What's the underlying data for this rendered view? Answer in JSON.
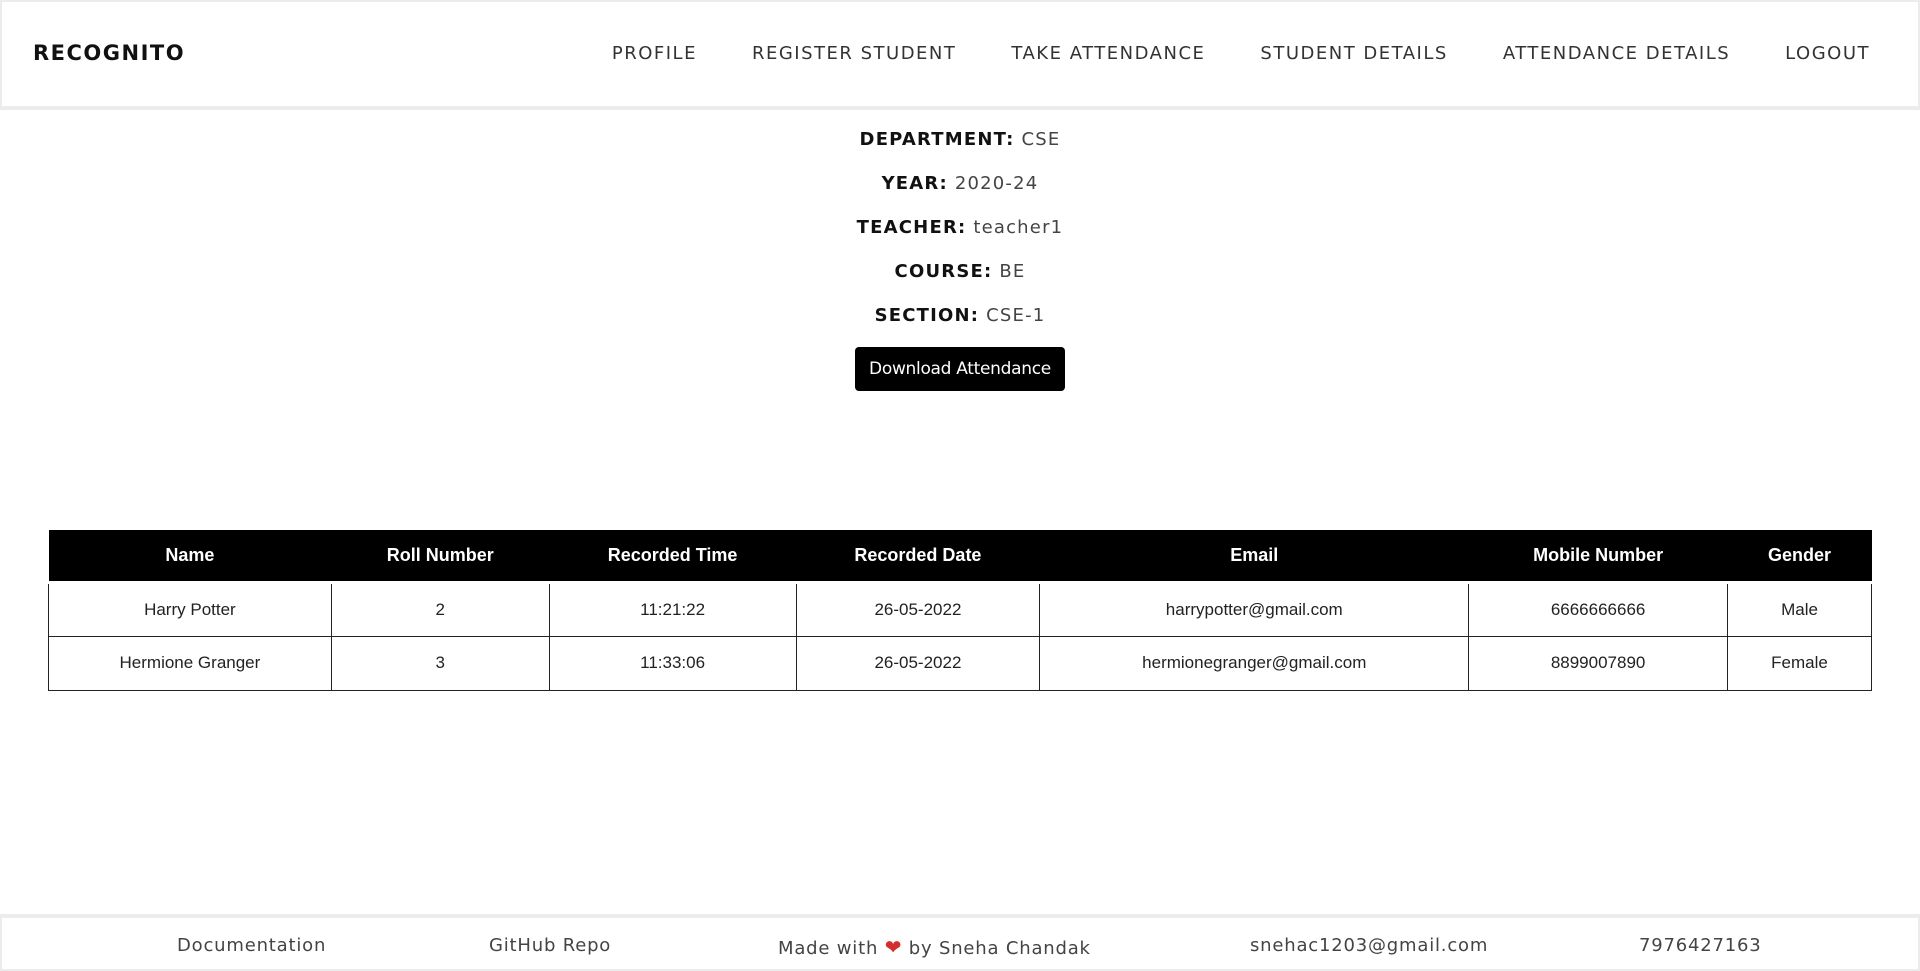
{
  "brand": "RECOGNITO",
  "nav": {
    "items": [
      "PROFILE",
      "REGISTER STUDENT",
      "TAKE ATTENDANCE",
      "STUDENT DETAILS",
      "ATTENDANCE DETAILS",
      "LOGOUT"
    ]
  },
  "info": {
    "department_label": "DEPARTMENT:",
    "department_value": "CSE",
    "year_label": "YEAR:",
    "year_value": "2020-24",
    "teacher_label": "TEACHER:",
    "teacher_value": "teacher1",
    "course_label": "COURSE:",
    "course_value": "BE",
    "section_label": "SECTION:",
    "section_value": "CSE-1"
  },
  "download_button": "Download Attendance",
  "table": {
    "headers": [
      "Name",
      "Roll Number",
      "Recorded Time",
      "Recorded Date",
      "Email",
      "Mobile Number",
      "Gender"
    ],
    "rows": [
      [
        "Harry Potter",
        "2",
        "11:21:22",
        "26-05-2022",
        "harrypotter@gmail.com",
        "6666666666",
        "Male"
      ],
      [
        "Hermione Granger",
        "3",
        "11:33:06",
        "26-05-2022",
        "hermionegranger@gmail.com",
        "8899007890",
        "Female"
      ]
    ]
  },
  "footer": {
    "documentation": "Documentation",
    "github": "GitHub Repo",
    "made_with": "Made with",
    "by": "by Sneha Chandak",
    "email": "snehac1203@gmail.com",
    "phone": "7976427163",
    "heart_icon": "heart-icon",
    "heart_color": "#d32f2f"
  }
}
